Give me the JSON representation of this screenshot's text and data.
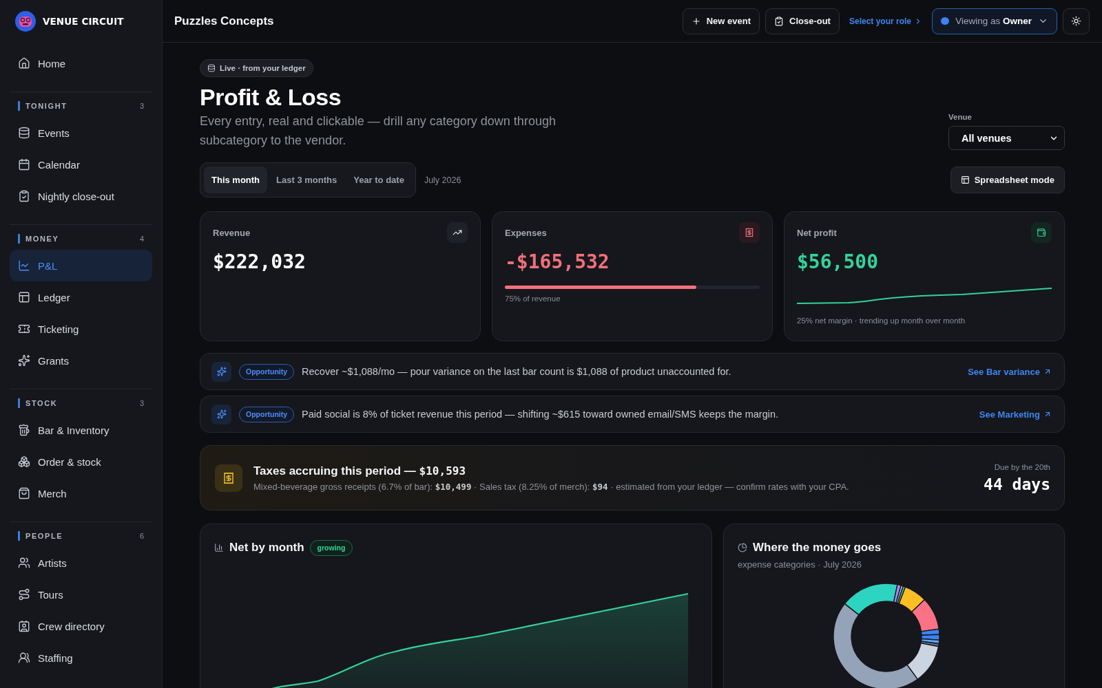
{
  "brand": {
    "name": "VENUE CIRCUIT"
  },
  "sidebar": {
    "home": {
      "label": "Home",
      "selected": false
    },
    "sections": [
      {
        "title": "TONIGHT",
        "count": "3",
        "items": [
          {
            "label": "Events",
            "selected": false
          },
          {
            "label": "Calendar",
            "selected": false
          },
          {
            "label": "Nightly close-out",
            "selected": false
          }
        ]
      },
      {
        "title": "MONEY",
        "count": "4",
        "items": [
          {
            "label": "P&L",
            "selected": true
          },
          {
            "label": "Ledger",
            "selected": false
          },
          {
            "label": "Ticketing",
            "selected": false
          },
          {
            "label": "Grants",
            "selected": false
          }
        ]
      },
      {
        "title": "STOCK",
        "count": "3",
        "items": [
          {
            "label": "Bar & Inventory",
            "selected": false
          },
          {
            "label": "Order & stock",
            "selected": false
          },
          {
            "label": "Merch",
            "selected": false
          }
        ]
      },
      {
        "title": "PEOPLE",
        "count": "6",
        "items": [
          {
            "label": "Artists",
            "selected": false
          },
          {
            "label": "Tours",
            "selected": false
          },
          {
            "label": "Crew directory",
            "selected": false
          },
          {
            "label": "Staffing",
            "selected": false
          }
        ]
      }
    ]
  },
  "topbar": {
    "title": "Puzzles Concepts",
    "actions": [
      {
        "label": "New event"
      },
      {
        "label": "Close-out"
      }
    ],
    "role_link": "Select your role",
    "viewer": "Viewing as **Owner**"
  },
  "header": {
    "badge": "Live · from your ledger",
    "title": "Profit & Loss",
    "subtitle": "Every entry, real and clickable — drill any category down through subcategory to the vendor.",
    "venue": {
      "label": "Venue",
      "value": "All venues"
    },
    "periods": [
      {
        "label": "This month",
        "selected": true
      },
      {
        "label": "Last 3 months",
        "selected": false
      },
      {
        "label": "Year to date",
        "selected": false
      }
    ],
    "period_label": "July 2026",
    "spreadsheet_button": "Spreadsheet mode"
  },
  "kpis": [
    {
      "kind": "plain",
      "label": "Revenue",
      "value": "$222,032"
    },
    {
      "kind": "bar",
      "label": "Expenses",
      "value": "-$165,532",
      "level": 0.75,
      "note": "75% of revenue"
    },
    {
      "kind": "sparkline",
      "label": "Net profit",
      "value": "$56,500",
      "note": "25% net margin · trending up month over month"
    }
  ],
  "opportunities": [
    {
      "badge": "Opportunity",
      "text": "Recover ~$1,088/mo — pour variance on the last bar count is $1,088 of product unaccounted for.",
      "link": "See Bar variance"
    },
    {
      "badge": "Opportunity",
      "text": "Paid social is 8% of ticket revenue this period — shifting ~$615 toward owned email/SMS keeps the margin.",
      "link": "See Marketing"
    }
  ],
  "taxes": {
    "title": "Taxes accruing this period —",
    "amount": "$10,593",
    "detail": "Mixed-beverage gross receipts (6.7% of bar): **$10,499** · Sales tax (8.25% of merch): **$94** · estimated from your ledger — confirm rates with your CPA.",
    "due_label": "Due by the 20th",
    "due_value": "44 days"
  },
  "net_by_month": {
    "title": "Net by month",
    "badge": "growing"
  },
  "spending": {
    "title": "Where the money goes",
    "subtitle": "expense categories · July 2026"
  }
}
